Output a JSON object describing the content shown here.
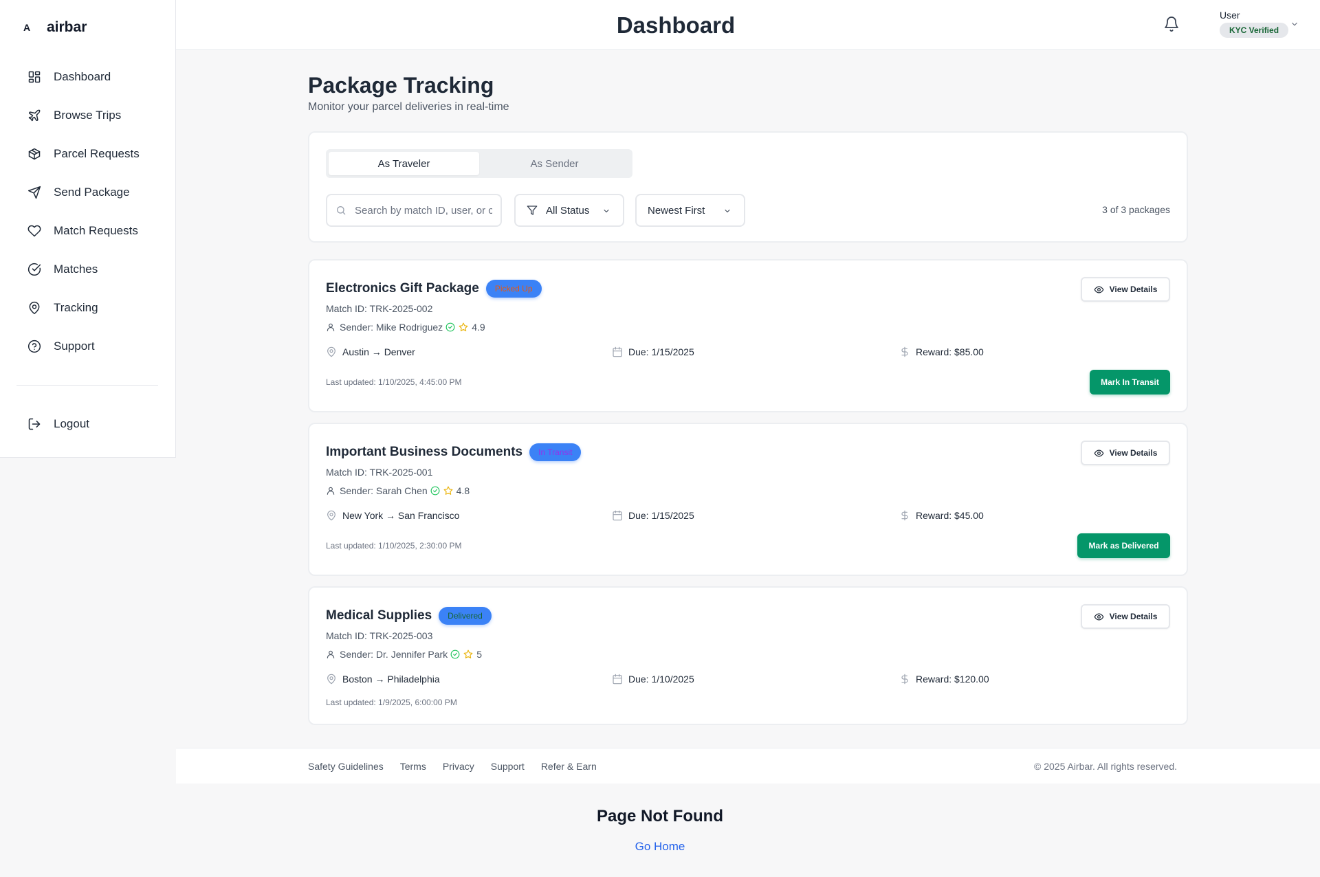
{
  "brand": {
    "mark": "A",
    "name": "airbar"
  },
  "sidebar": {
    "items": [
      {
        "label": "Dashboard",
        "icon": "dashboard-icon"
      },
      {
        "label": "Browse Trips",
        "icon": "plane-icon"
      },
      {
        "label": "Parcel Requests",
        "icon": "package-icon"
      },
      {
        "label": "Send Package",
        "icon": "send-icon"
      },
      {
        "label": "Match Requests",
        "icon": "heart-icon"
      },
      {
        "label": "Matches",
        "icon": "check-circle-icon"
      },
      {
        "label": "Tracking",
        "icon": "map-pin-icon"
      },
      {
        "label": "Support",
        "icon": "help-circle-icon"
      }
    ],
    "logout_label": "Logout"
  },
  "header": {
    "title": "Dashboard",
    "user_name": "User",
    "kyc_badge": "KYC Verified"
  },
  "main": {
    "title": "Package Tracking",
    "subtitle": "Monitor your parcel deliveries in real-time",
    "tabs": [
      {
        "label": "As Traveler",
        "active": true
      },
      {
        "label": "As Sender",
        "active": false
      }
    ],
    "search": {
      "placeholder": "Search by match ID, user, or city..."
    },
    "status_filter": "All Status",
    "sort": "Newest First",
    "count_text": "3 of 3 packages"
  },
  "packages": [
    {
      "title": "Electronics Gift Package",
      "status": "Picked Up",
      "status_color": "#ea580c",
      "match_id": "Match ID: TRK-2025-002",
      "sender": "Sender: Mike Rodriguez",
      "rating": "4.9",
      "route": "Austin → Denver",
      "due": "Due: 1/15/2025",
      "reward": "Reward: $85.00",
      "updated": "Last updated: 1/10/2025, 4:45:00 PM",
      "action": "Mark In Transit"
    },
    {
      "title": "Important Business Documents",
      "status": "In Transit",
      "status_color": "#9333ea",
      "match_id": "Match ID: TRK-2025-001",
      "sender": "Sender: Sarah Chen",
      "rating": "4.8",
      "route": "New York → San Francisco",
      "due": "Due: 1/15/2025",
      "reward": "Reward: $45.00",
      "updated": "Last updated: 1/10/2025, 2:30:00 PM",
      "action": "Mark as Delivered"
    },
    {
      "title": "Medical Supplies",
      "status": "Delivered",
      "status_color": "#166534",
      "match_id": "Match ID: TRK-2025-003",
      "sender": "Sender: Dr. Jennifer Park",
      "rating": "5",
      "route": "Boston → Philadelphia",
      "due": "Due: 1/10/2025",
      "reward": "Reward: $120.00",
      "updated": "Last updated: 1/9/2025, 6:00:00 PM",
      "action": ""
    }
  ],
  "view_details_label": "View Details",
  "footer": {
    "links": [
      "Safety Guidelines",
      "Terms",
      "Privacy",
      "Support",
      "Refer & Earn"
    ],
    "copyright": "© 2025 Airbar. All rights reserved."
  },
  "not_found": {
    "title": "Page Not Found",
    "link": "Go Home"
  },
  "colors": {
    "accent": "#3b82f6",
    "success": "#059669",
    "verified": "#22c55e",
    "star": "#eab308"
  }
}
